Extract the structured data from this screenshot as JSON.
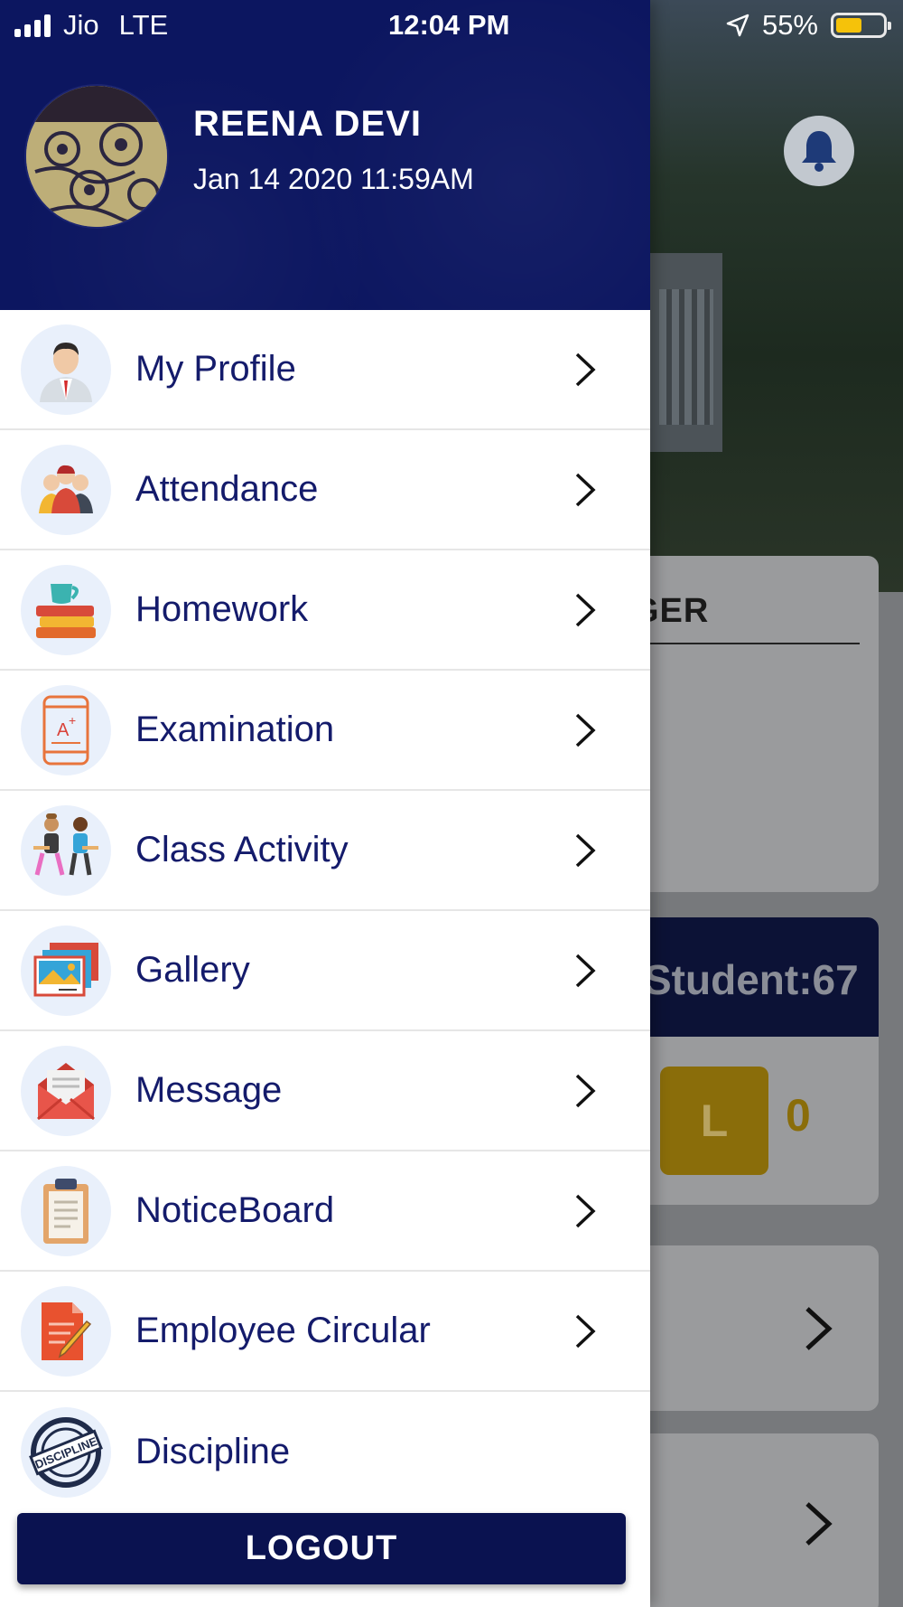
{
  "status_bar": {
    "carrier": "Jio",
    "network": "LTE",
    "time": "12:04 PM",
    "battery": "55%",
    "battery_level": 0.55
  },
  "drawer": {
    "user_name": "REENA DEVI",
    "user_datetime": "Jan 14 2020 11:59AM",
    "menu_items": [
      {
        "label": "My Profile",
        "icon": "profile-icon"
      },
      {
        "label": "Attendance",
        "icon": "attendance-icon"
      },
      {
        "label": "Homework",
        "icon": "homework-icon"
      },
      {
        "label": "Examination",
        "icon": "examination-icon"
      },
      {
        "label": "Class Activity",
        "icon": "class-activity-icon"
      },
      {
        "label": "Gallery",
        "icon": "gallery-icon"
      },
      {
        "label": "Message",
        "icon": "message-icon"
      },
      {
        "label": "NoticeBoard",
        "icon": "noticeboard-icon"
      },
      {
        "label": "Employee Circular",
        "icon": "employee-circular-icon"
      },
      {
        "label": "Discipline",
        "icon": "discipline-icon"
      }
    ],
    "discipline_badge_text": "DISCIPLINE",
    "logout_label": "LOGOUT"
  },
  "background": {
    "card_title_partial": "GER",
    "student_text": "Student:67",
    "leave_letter": "L",
    "leave_count": "0"
  },
  "colors": {
    "drawer_header": "#0c1660",
    "menu_text": "#141b6b",
    "logout_bg": "#0a1250",
    "battery_fill": "#f5c20a"
  }
}
